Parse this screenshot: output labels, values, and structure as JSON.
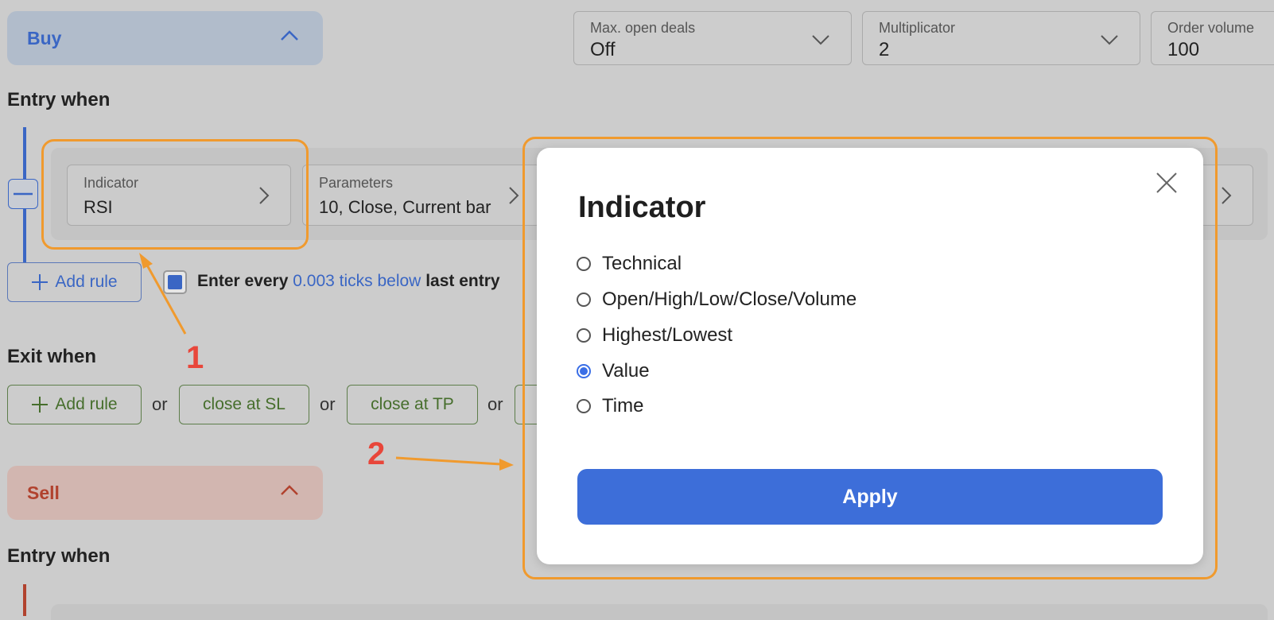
{
  "buy_section": {
    "label": "Buy"
  },
  "top_controls": {
    "max_open_deals": {
      "caption": "Max. open deals",
      "value": "Off"
    },
    "multiplicator": {
      "caption": "Multiplicator",
      "value": "2"
    },
    "order_volume": {
      "caption": "Order volume",
      "value": "100"
    }
  },
  "entry_when_label": "Entry when",
  "rule": {
    "indicator": {
      "caption": "Indicator",
      "value": "RSI"
    },
    "parameters": {
      "caption": "Parameters",
      "value": "10, Close, Current bar"
    }
  },
  "add_rule_label": "Add rule",
  "enter_every": {
    "prefix": "Enter every",
    "link": "0.003 ticks below",
    "suffix": "last entry"
  },
  "exit_when_label": "Exit when",
  "exit_buttons": {
    "add_rule": "Add rule",
    "or": "or",
    "close_sl": "close at SL",
    "close_tp": "close at TP"
  },
  "sell_section": {
    "label": "Sell"
  },
  "entry_when_label_2": "Entry when",
  "annotations": {
    "one": "1",
    "two": "2"
  },
  "modal": {
    "title": "Indicator",
    "options": [
      "Technical",
      "Open/High/Low/Close/Volume",
      "Highest/Lowest",
      "Value",
      "Time"
    ],
    "selected": "Value",
    "apply_label": "Apply"
  },
  "colors": {
    "accent_blue": "#3d6ed9",
    "annotation_orange": "#f09a2e",
    "annotation_red": "#e8463a"
  }
}
